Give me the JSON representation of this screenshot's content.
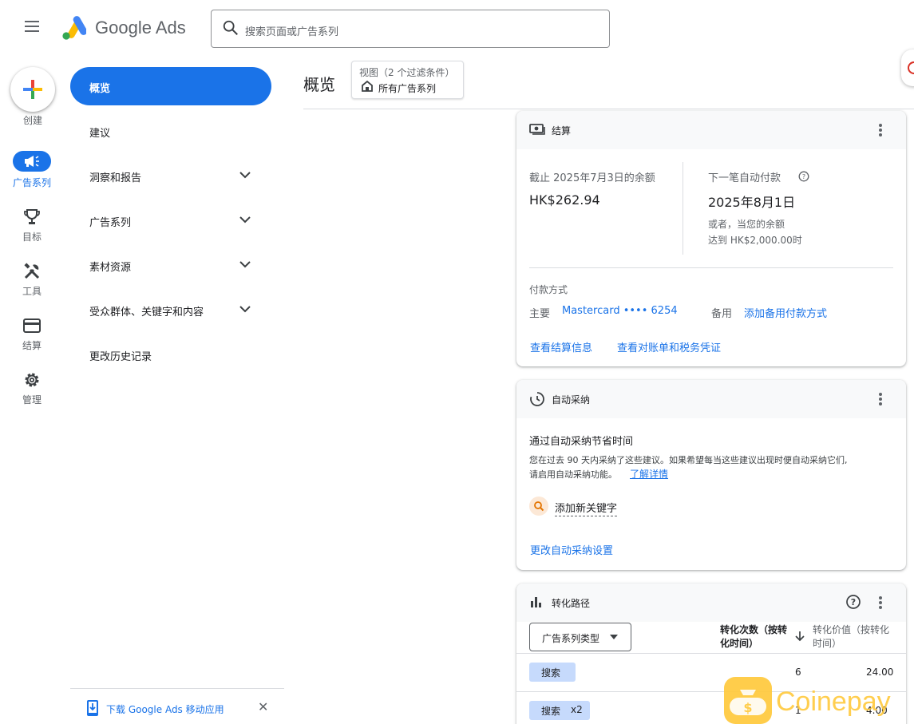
{
  "header": {
    "app_name": "Google Ads",
    "search_placeholder": "搜索页面或广告系列"
  },
  "create": {
    "label": "创建"
  },
  "rail": [
    {
      "label": "广告系列",
      "icon": "megaphone-icon",
      "active": true
    },
    {
      "label": "目标",
      "icon": "trophy-icon"
    },
    {
      "label": "工具",
      "icon": "tools-icon"
    },
    {
      "label": "结算",
      "icon": "credit-card-icon"
    },
    {
      "label": "管理",
      "icon": "gear-icon"
    }
  ],
  "nav": {
    "active": "概览",
    "items": [
      {
        "label": "建议",
        "expandable": false
      },
      {
        "label": "洞察和报告",
        "expandable": true
      },
      {
        "label": "广告系列",
        "expandable": true
      },
      {
        "label": "素材资源",
        "expandable": true
      },
      {
        "label": "受众群体、关键字和内容",
        "expandable": true
      },
      {
        "label": "更改历史记录",
        "expandable": false
      }
    ],
    "download_app": "下载 Google Ads 移动应用",
    "close": "✕"
  },
  "page": {
    "title": "概览",
    "view_line1": "视图（2 个过滤条件）",
    "view_line2": "所有广告系列"
  },
  "billing": {
    "title": "结算",
    "balance_label": "截止 2025年7月3日的余额",
    "balance_value": "HK$262.94",
    "next_payment_label": "下一笔自动付款",
    "next_payment_date": "2025年8月1日",
    "next_payment_note1": "或者，当您的余额",
    "next_payment_note2": "达到 HK$2,000.00时",
    "payment_method_label": "付款方式",
    "primary_label": "主要",
    "primary_value": "Mastercard •••• 6254",
    "backup_label": "备用",
    "backup_link": "添加备用付款方式",
    "link_billing": "查看结算信息",
    "link_statements": "查看对账单和税务凭证"
  },
  "auto_apply": {
    "title": "自动采纳",
    "heading": "通过自动采纳节省时间",
    "desc1": "您在过去 90 天内采纳了这些建议。如果希望每当这些建议出现时便自动采纳它们,",
    "desc2": "请启用自动采纳功能。",
    "learn_more": "了解详情",
    "item": "添加新关键字",
    "settings_link": "更改自动采纳设置"
  },
  "conversion": {
    "title": "转化路径",
    "dropdown": "广告系列类型",
    "col1a": "转化次数（按转",
    "col1b": "化时间）",
    "col2a": "转化价值（按转化",
    "col2b": "时间）",
    "rows": [
      {
        "chip": "搜索",
        "count": "6",
        "value": "24.00"
      },
      {
        "chip": "搜索",
        "chip_suffix": "x2",
        "count": "1",
        "value": "4.00"
      }
    ]
  },
  "watermark": {
    "text": "Coinepay"
  }
}
